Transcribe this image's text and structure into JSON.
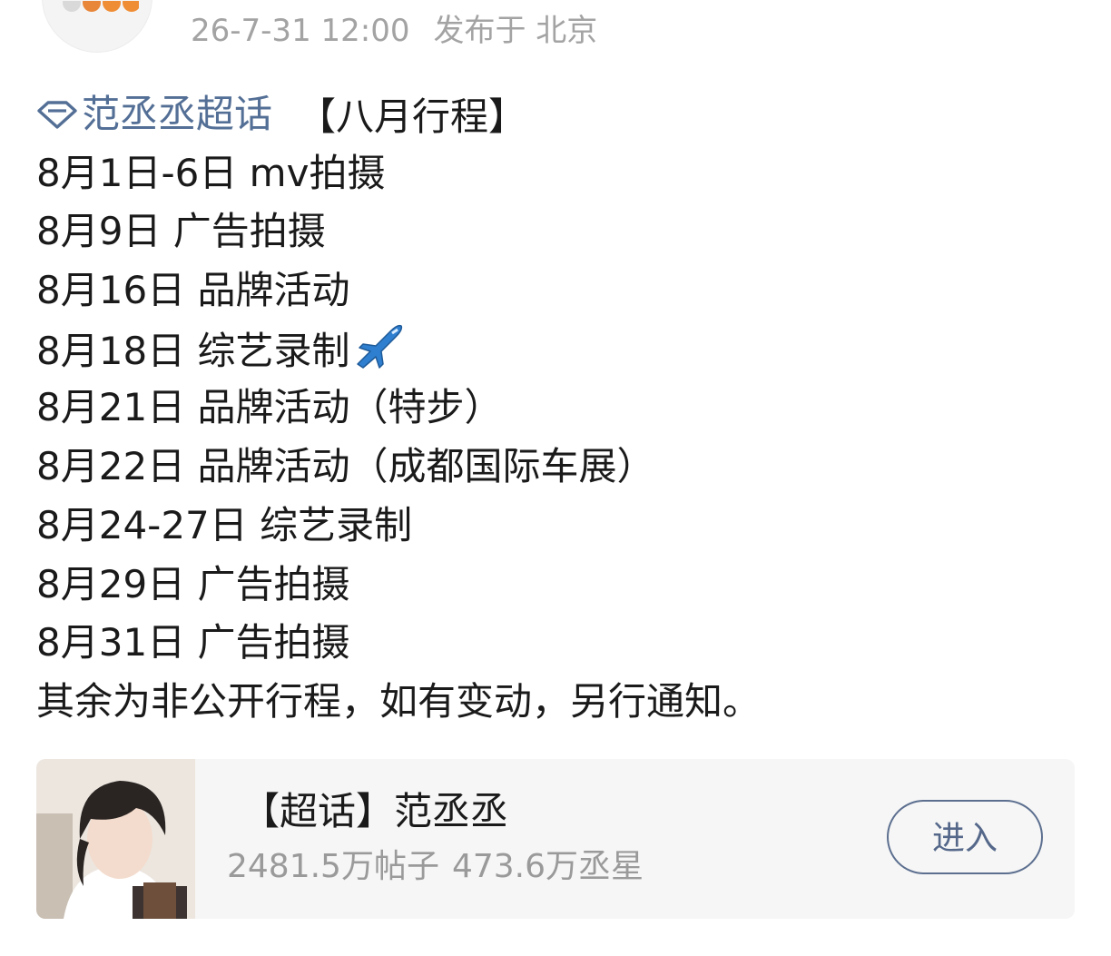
{
  "header": {
    "timestamp": "26-7-31 12:00",
    "published_label": "发布于 北京"
  },
  "post": {
    "topic_tag": "范丞丞超话",
    "topic_icon": "diamond-icon",
    "title": "【八月行程】",
    "schedule": [
      "8月1日-6日 mv拍摄",
      "8月9日 广告拍摄",
      "8月16日 品牌活动",
      "8月18日 综艺录制",
      "8月21日 品牌活动（特步）",
      "8月22日 品牌活动（成都国际车展）",
      "8月24-27日 综艺录制",
      "8月29日 广告拍摄",
      "8月31日 广告拍摄"
    ],
    "footer_note": "其余为非公开行程，如有变动，另行通知。",
    "plane_emoji_after_item": 3
  },
  "card": {
    "title": "【超话】范丞丞",
    "posts_count": "2481.5万帖子",
    "fans_count": "473.6万丞星",
    "enter_label": "进入"
  },
  "colors": {
    "tag": "#546f96",
    "meta": "#a3a3a3",
    "text": "#1a1a1a",
    "card_bg": "#f6f6f6",
    "button_border": "#5c6f8f"
  }
}
